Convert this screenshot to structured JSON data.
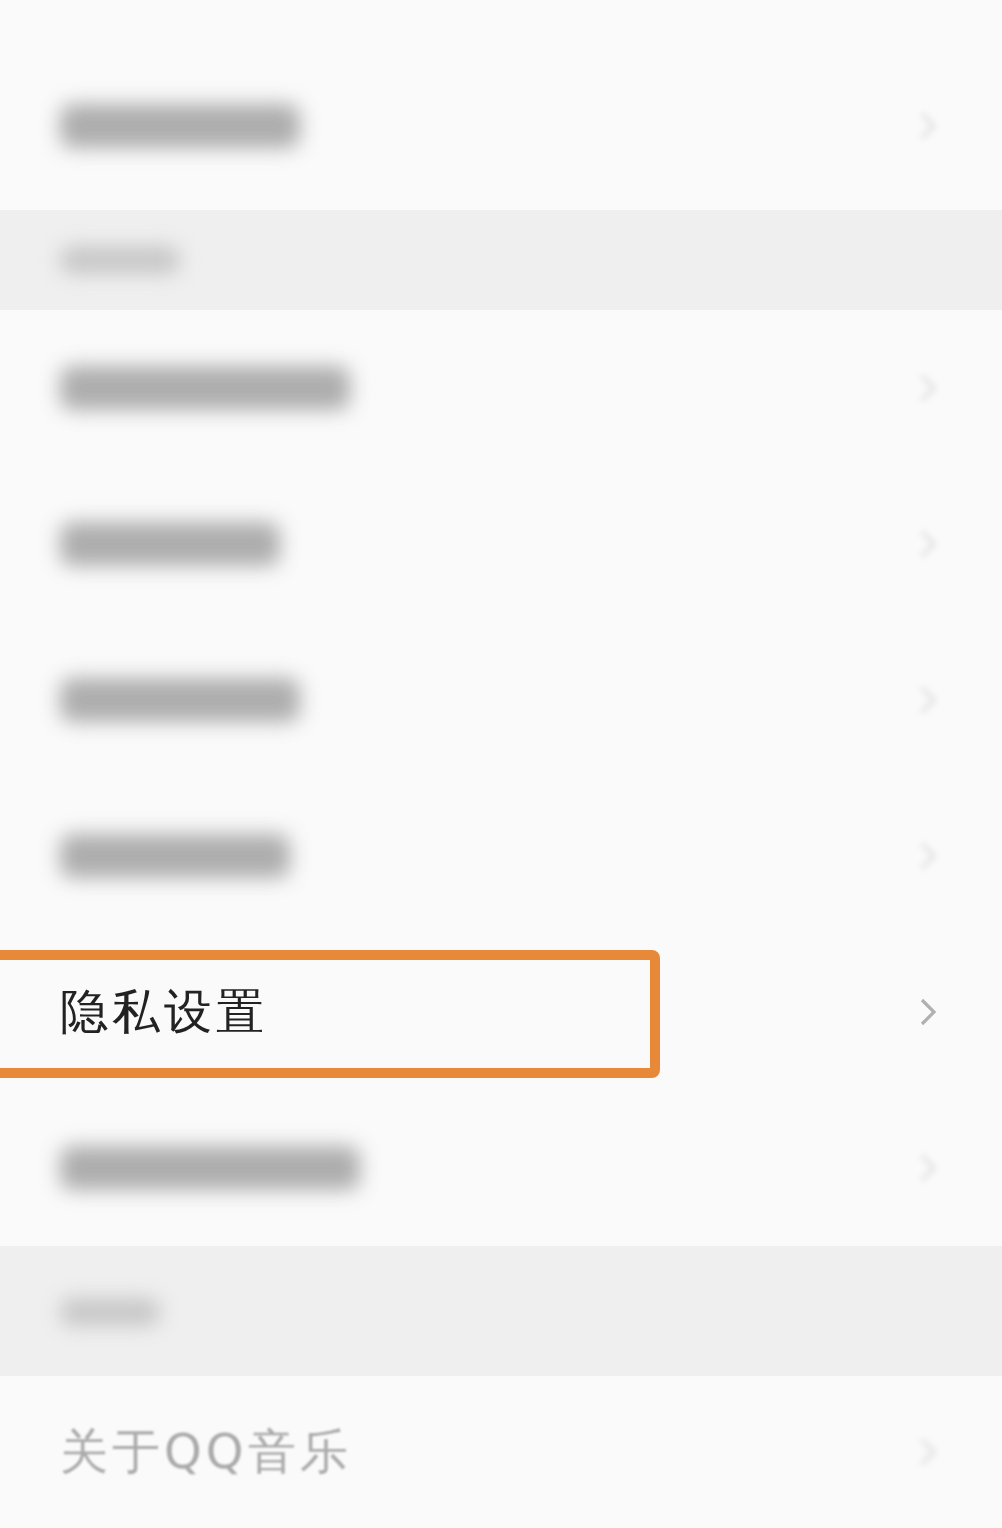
{
  "rows": [
    {
      "kind": "blurred-item"
    },
    {
      "kind": "blurred-header"
    },
    {
      "kind": "blurred-item"
    },
    {
      "kind": "blurred-item"
    },
    {
      "kind": "blurred-item"
    },
    {
      "kind": "blurred-item"
    },
    {
      "kind": "item",
      "label": "隐私设置",
      "highlighted": true
    },
    {
      "kind": "blurred-item"
    },
    {
      "kind": "blurred-header"
    },
    {
      "kind": "faded-item",
      "label": "关于QQ音乐"
    }
  ]
}
